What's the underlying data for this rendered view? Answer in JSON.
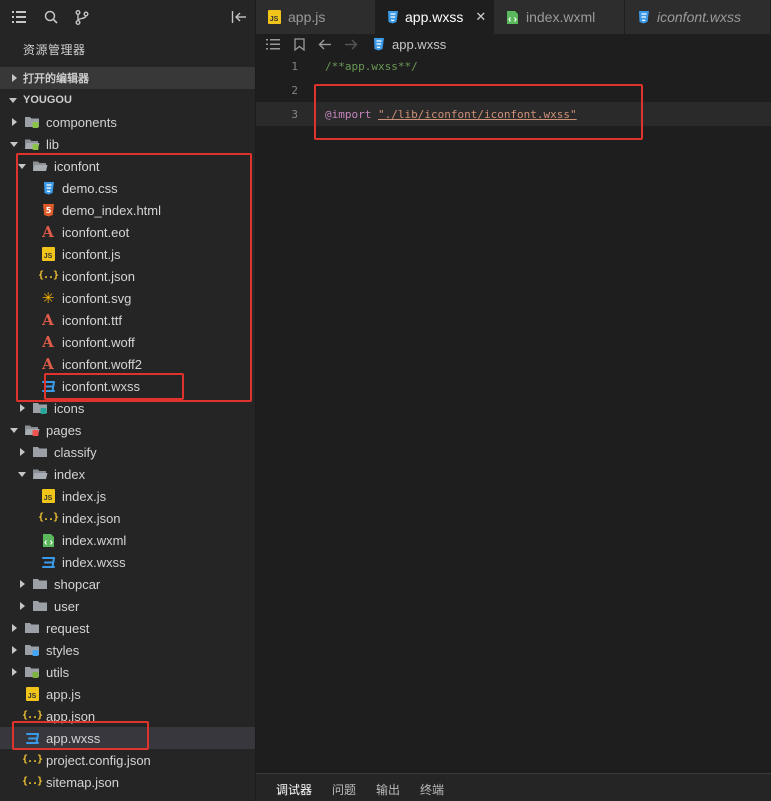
{
  "sidebar": {
    "title": "资源管理器",
    "sections": {
      "open_editors": "打开的编辑器",
      "project": "YOUGOU"
    },
    "tree": [
      {
        "label": "components",
        "depth": 1,
        "kind": "folder-special",
        "icon": "components-folder-icon",
        "twisty": "collapsed"
      },
      {
        "label": "lib",
        "depth": 1,
        "kind": "folder-special",
        "icon": "lib-folder-icon",
        "twisty": "expanded"
      },
      {
        "label": "iconfont",
        "depth": 2,
        "kind": "folder",
        "icon": "folder-open-icon",
        "twisty": "expanded"
      },
      {
        "label": "demo.css",
        "depth": 3,
        "kind": "css",
        "icon": "css-file-icon"
      },
      {
        "label": "demo_index.html",
        "depth": 3,
        "kind": "html",
        "icon": "html-file-icon"
      },
      {
        "label": "iconfont.eot",
        "depth": 3,
        "kind": "font",
        "icon": "font-file-icon"
      },
      {
        "label": "iconfont.js",
        "depth": 3,
        "kind": "js",
        "icon": "js-file-icon"
      },
      {
        "label": "iconfont.json",
        "depth": 3,
        "kind": "json",
        "icon": "json-file-icon"
      },
      {
        "label": "iconfont.svg",
        "depth": 3,
        "kind": "svg",
        "icon": "svg-file-icon"
      },
      {
        "label": "iconfont.ttf",
        "depth": 3,
        "kind": "font",
        "icon": "font-file-icon"
      },
      {
        "label": "iconfont.woff",
        "depth": 3,
        "kind": "font",
        "icon": "font-file-icon"
      },
      {
        "label": "iconfont.woff2",
        "depth": 3,
        "kind": "font",
        "icon": "font-file-icon"
      },
      {
        "label": "iconfont.wxss",
        "depth": 3,
        "kind": "wxss",
        "icon": "wxss-file-icon"
      },
      {
        "label": "icons",
        "depth": 2,
        "kind": "folder-special",
        "icon": "image-folder-icon",
        "twisty": "collapsed"
      },
      {
        "label": "pages",
        "depth": 1,
        "kind": "folder-special",
        "icon": "pages-folder-icon",
        "twisty": "expanded"
      },
      {
        "label": "classify",
        "depth": 2,
        "kind": "folder",
        "icon": "folder-icon",
        "twisty": "collapsed"
      },
      {
        "label": "index",
        "depth": 2,
        "kind": "folder",
        "icon": "folder-open-icon",
        "twisty": "expanded"
      },
      {
        "label": "index.js",
        "depth": 3,
        "kind": "js",
        "icon": "js-file-icon"
      },
      {
        "label": "index.json",
        "depth": 3,
        "kind": "json",
        "icon": "json-file-icon"
      },
      {
        "label": "index.wxml",
        "depth": 3,
        "kind": "wxml",
        "icon": "wxml-file-icon"
      },
      {
        "label": "index.wxss",
        "depth": 3,
        "kind": "wxss",
        "icon": "wxss-file-icon"
      },
      {
        "label": "shopcar",
        "depth": 2,
        "kind": "folder",
        "icon": "folder-icon",
        "twisty": "collapsed"
      },
      {
        "label": "user",
        "depth": 2,
        "kind": "folder",
        "icon": "folder-icon",
        "twisty": "collapsed"
      },
      {
        "label": "request",
        "depth": 1,
        "kind": "folder",
        "icon": "folder-icon",
        "twisty": "collapsed"
      },
      {
        "label": "styles",
        "depth": 1,
        "kind": "folder-special",
        "icon": "styles-folder-icon",
        "twisty": "collapsed"
      },
      {
        "label": "utils",
        "depth": 1,
        "kind": "folder-special",
        "icon": "utils-folder-icon",
        "twisty": "collapsed"
      },
      {
        "label": "app.js",
        "depth": 1,
        "kind": "js",
        "icon": "js-file-icon"
      },
      {
        "label": "app.json",
        "depth": 1,
        "kind": "json",
        "icon": "json-file-icon"
      },
      {
        "label": "app.wxss",
        "depth": 1,
        "kind": "wxss",
        "icon": "wxss-file-icon",
        "selected": true
      },
      {
        "label": "project.config.json",
        "depth": 1,
        "kind": "json",
        "icon": "json-file-icon"
      },
      {
        "label": "sitemap.json",
        "depth": 1,
        "kind": "json",
        "icon": "json-file-icon"
      }
    ]
  },
  "editor": {
    "tabs": [
      {
        "label": "app.js",
        "kind": "js",
        "active": false
      },
      {
        "label": "app.wxss",
        "kind": "wxss",
        "active": true,
        "close": "✕"
      },
      {
        "label": "index.wxml",
        "kind": "wxml",
        "active": false
      },
      {
        "label": "iconfont.wxss",
        "kind": "wxss",
        "active": false,
        "italic": true
      }
    ],
    "breadcrumb": "app.wxss",
    "lines": [
      {
        "num": "1",
        "tokens": [
          {
            "t": "/**app.wxss**/",
            "c": "comment"
          }
        ]
      },
      {
        "num": "2",
        "tokens": []
      },
      {
        "num": "3",
        "current": true,
        "tokens": [
          {
            "t": "@import",
            "c": "kw"
          },
          {
            "t": " ",
            "c": "pl"
          },
          {
            "t": "\"./lib/iconfont/iconfont.wxss\"",
            "c": "str"
          }
        ]
      }
    ]
  },
  "panel": {
    "tabs": [
      "调试器",
      "问题",
      "输出",
      "终端"
    ]
  },
  "colors": {
    "annotation": "#e0332c",
    "css_blue": "#3b9ae8",
    "html_orange": "#e05c2a",
    "js_yellow": "#f0c419",
    "wxml_green": "#5cb85c"
  }
}
